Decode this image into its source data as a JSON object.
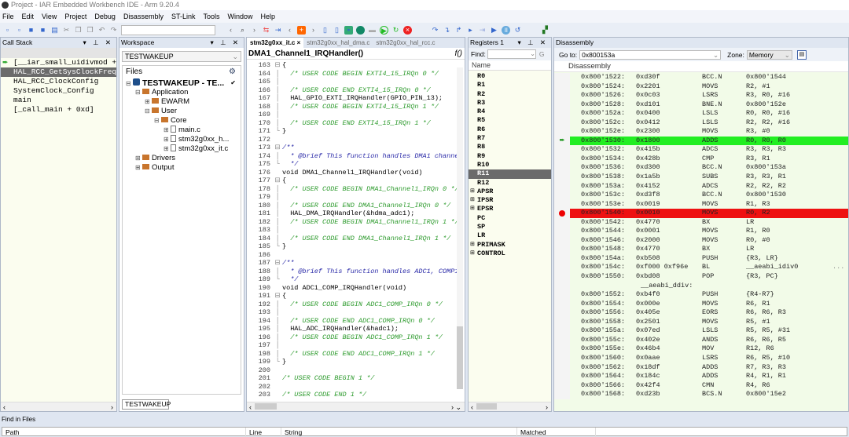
{
  "window": {
    "title": "Project - IAR Embedded Workbench IDE - Arm 9.20.4"
  },
  "menu": [
    "File",
    "Edit",
    "View",
    "Project",
    "Debug",
    "Disassembly",
    "ST-Link",
    "Tools",
    "Window",
    "Help"
  ],
  "call_stack": {
    "title": "Call Stack",
    "items": [
      "[__iar_small_uidivmod +",
      "HAL_RCC_GetSysClockFreq",
      "HAL_RCC_ClockConfig",
      "SystemClock_Config",
      "main",
      "[_call_main + 0xd]"
    ],
    "selected": 1,
    "current": 0
  },
  "workspace": {
    "title": "Workspace",
    "config": "TESTWAKEUP",
    "files_header": "Files",
    "bottom_tab": "TESTWAKEUP",
    "tree": [
      {
        "label": "TESTWAKEUP - TE...",
        "depth": 0,
        "kind": "project"
      },
      {
        "label": "Application",
        "depth": 1,
        "kind": "folder"
      },
      {
        "label": "EWARM",
        "depth": 2,
        "kind": "folder"
      },
      {
        "label": "User",
        "depth": 2,
        "kind": "folder"
      },
      {
        "label": "Core",
        "depth": 3,
        "kind": "folder"
      },
      {
        "label": "main.c",
        "depth": 4,
        "kind": "file"
      },
      {
        "label": "stm32g0xx_h...",
        "depth": 4,
        "kind": "file"
      },
      {
        "label": "stm32g0xx_it.c",
        "depth": 4,
        "kind": "file"
      },
      {
        "label": "Drivers",
        "depth": 1,
        "kind": "folder"
      },
      {
        "label": "Output",
        "depth": 1,
        "kind": "folder"
      }
    ]
  },
  "editor": {
    "tabs": [
      "stm32g0xx_it.c",
      "stm32g0xx_hal_dma.c",
      "stm32g0xx_hal_rcc.c"
    ],
    "active_tab": 0,
    "function": "DMA1_Channel1_IRQHandler()",
    "lines": [
      {
        "n": "163",
        "f": "⊟",
        "t": "{",
        "c": ""
      },
      {
        "n": "164",
        "f": "│",
        "t": "  /* USER CODE BEGIN EXTI4_15_IRQn 0 */",
        "c": "c-com"
      },
      {
        "n": "165",
        "f": "│",
        "t": "",
        "c": ""
      },
      {
        "n": "166",
        "f": "│",
        "t": "  /* USER CODE END EXTI4_15_IRQn 0 */",
        "c": "c-com"
      },
      {
        "n": "167",
        "f": "│",
        "t": "  HAL_GPIO_EXTI_IRQHandler(GPIO_PIN_13);",
        "c": ""
      },
      {
        "n": "168",
        "f": "│",
        "t": "  /* USER CODE BEGIN EXTI4_15_IRQn 1 */",
        "c": "c-com"
      },
      {
        "n": "169",
        "f": "│",
        "t": "",
        "c": ""
      },
      {
        "n": "170",
        "f": "│",
        "t": "  /* USER CODE END EXTI4_15_IRQn 1 */",
        "c": "c-com"
      },
      {
        "n": "171",
        "f": "└",
        "t": "}",
        "c": ""
      },
      {
        "n": "172",
        "f": "",
        "t": "",
        "c": ""
      },
      {
        "n": "173",
        "f": "⊟",
        "t": "/**",
        "c": "c-doc"
      },
      {
        "n": "174",
        "f": "│",
        "t": "  * @brief This function handles DMA1 channe",
        "c": "c-doc"
      },
      {
        "n": "175",
        "f": "└",
        "t": "  */",
        "c": "c-doc"
      },
      {
        "n": "176",
        "f": "",
        "t": "void DMA1_Channel1_IRQHandler(void)",
        "c": ""
      },
      {
        "n": "177",
        "f": "⊟",
        "t": "{",
        "c": ""
      },
      {
        "n": "178",
        "f": "│",
        "t": "  /* USER CODE BEGIN DMA1_Channel1_IRQn 0 */",
        "c": "c-com"
      },
      {
        "n": "179",
        "f": "│",
        "t": "",
        "c": ""
      },
      {
        "n": "180",
        "f": "│",
        "t": "  /* USER CODE END DMA1_Channel1_IRQn 0 */",
        "c": "c-com"
      },
      {
        "n": "181",
        "f": "│",
        "t": "  HAL_DMA_IRQHandler(&hdma_adc1);",
        "c": ""
      },
      {
        "n": "182",
        "f": "│",
        "t": "  /* USER CODE BEGIN DMA1_Channel1_IRQn 1 */",
        "c": "c-com"
      },
      {
        "n": "183",
        "f": "│",
        "t": "",
        "c": ""
      },
      {
        "n": "184",
        "f": "│",
        "t": "  /* USER CODE END DMA1_Channel1_IRQn 1 */",
        "c": "c-com"
      },
      {
        "n": "185",
        "f": "└",
        "t": "}",
        "c": ""
      },
      {
        "n": "186",
        "f": "",
        "t": "",
        "c": ""
      },
      {
        "n": "187",
        "f": "⊟",
        "t": "/**",
        "c": "c-doc"
      },
      {
        "n": "188",
        "f": "│",
        "t": "  * @brief This function handles ADC1, COMP1",
        "c": "c-doc"
      },
      {
        "n": "189",
        "f": "└",
        "t": "  */",
        "c": "c-doc"
      },
      {
        "n": "190",
        "f": "",
        "t": "void ADC1_COMP_IRQHandler(void)",
        "c": ""
      },
      {
        "n": "191",
        "f": "⊟",
        "t": "{",
        "c": ""
      },
      {
        "n": "192",
        "f": "│",
        "t": "  /* USER CODE BEGIN ADC1_COMP_IRQn 0 */",
        "c": "c-com"
      },
      {
        "n": "193",
        "f": "│",
        "t": "",
        "c": ""
      },
      {
        "n": "194",
        "f": "│",
        "t": "  /* USER CODE END ADC1_COMP_IRQn 0 */",
        "c": "c-com"
      },
      {
        "n": "195",
        "f": "│",
        "t": "  HAL_ADC_IRQHandler(&hadc1);",
        "c": ""
      },
      {
        "n": "196",
        "f": "│",
        "t": "  /* USER CODE BEGIN ADC1_COMP_IRQn 1 */",
        "c": "c-com"
      },
      {
        "n": "197",
        "f": "│",
        "t": "",
        "c": ""
      },
      {
        "n": "198",
        "f": "│",
        "t": "  /* USER CODE END ADC1_COMP_IRQn 1 */",
        "c": "c-com"
      },
      {
        "n": "199",
        "f": "└",
        "t": "}",
        "c": ""
      },
      {
        "n": "200",
        "f": "",
        "t": "",
        "c": ""
      },
      {
        "n": "201",
        "f": "",
        "t": "/* USER CODE BEGIN 1 */",
        "c": "c-com"
      },
      {
        "n": "202",
        "f": "",
        "t": "",
        "c": ""
      },
      {
        "n": "203",
        "f": "",
        "t": "/* USER CODE END 1 */",
        "c": "c-com"
      }
    ]
  },
  "registers": {
    "title": "Registers 1",
    "find_label": "Find:",
    "find_value": "",
    "col_header": "Name",
    "items": [
      {
        "name": "R0"
      },
      {
        "name": "R1"
      },
      {
        "name": "R2"
      },
      {
        "name": "R3"
      },
      {
        "name": "R4"
      },
      {
        "name": "R5"
      },
      {
        "name": "R6"
      },
      {
        "name": "R7"
      },
      {
        "name": "R8"
      },
      {
        "name": "R9"
      },
      {
        "name": "R10"
      },
      {
        "name": "R11",
        "selected": true
      },
      {
        "name": "R12"
      },
      {
        "name": "APSR",
        "expand": true
      },
      {
        "name": "IPSR",
        "expand": true
      },
      {
        "name": "EPSR",
        "expand": true
      },
      {
        "name": "PC"
      },
      {
        "name": "SP"
      },
      {
        "name": "LR"
      },
      {
        "name": "PRIMASK",
        "expand": true
      },
      {
        "name": "CONTROL",
        "expand": true
      }
    ]
  },
  "disassembly": {
    "title": "Disassembly",
    "goto_label": "Go to:",
    "goto_value": "0x800153a",
    "zone_label": "Zone:",
    "zone_value": "Memory",
    "col_header": "Disassembly",
    "rows": [
      {
        "a": "0x800'1522:",
        "h": "0xd30f",
        "m": "BCC.N",
        "o": "0x800'1544"
      },
      {
        "a": "0x800'1524:",
        "h": "0x2201",
        "m": "MOVS",
        "o": "R2, #1"
      },
      {
        "a": "0x800'1526:",
        "h": "0x0c03",
        "m": "LSRS",
        "o": "R3, R0, #16"
      },
      {
        "a": "0x800'1528:",
        "h": "0xd101",
        "m": "BNE.N",
        "o": "0x800'152e"
      },
      {
        "a": "0x800'152a:",
        "h": "0x0400",
        "m": "LSLS",
        "o": "R0, R0, #16"
      },
      {
        "a": "0x800'152c:",
        "h": "0x0412",
        "m": "LSLS",
        "o": "R2, R2, #16"
      },
      {
        "a": "0x800'152e:",
        "h": "0x2300",
        "m": "MOVS",
        "o": "R3, #0"
      },
      {
        "a": "0x800'1530:",
        "h": "0x1800",
        "m": "ADDS",
        "o": "R0, R0, R0",
        "state": "current"
      },
      {
        "a": "0x800'1532:",
        "h": "0x415b",
        "m": "ADCS",
        "o": "R3, R3, R3"
      },
      {
        "a": "0x800'1534:",
        "h": "0x428b",
        "m": "CMP",
        "o": "R3, R1"
      },
      {
        "a": "0x800'1536:",
        "h": "0xd300",
        "m": "BCC.N",
        "o": "0x800'153a"
      },
      {
        "a": "0x800'1538:",
        "h": "0x1a5b",
        "m": "SUBS",
        "o": "R3, R3, R1"
      },
      {
        "a": "0x800'153a:",
        "h": "0x4152",
        "m": "ADCS",
        "o": "R2, R2, R2"
      },
      {
        "a": "0x800'153c:",
        "h": "0xd3f8",
        "m": "BCC.N",
        "o": "0x800'1530"
      },
      {
        "a": "0x800'153e:",
        "h": "0x0019",
        "m": "MOVS",
        "o": "R1, R3"
      },
      {
        "a": "0x800'1540:",
        "h": "0x0010",
        "m": "MOVS",
        "o": "R0, R2",
        "state": "breakpoint"
      },
      {
        "a": "0x800'1542:",
        "h": "0x4770",
        "m": "BX",
        "o": "LR"
      },
      {
        "a": "0x800'1544:",
        "h": "0x0001",
        "m": "MOVS",
        "o": "R1, R0"
      },
      {
        "a": "0x800'1546:",
        "h": "0x2000",
        "m": "MOVS",
        "o": "R0, #0"
      },
      {
        "a": "0x800'1548:",
        "h": "0x4770",
        "m": "BX",
        "o": "LR"
      },
      {
        "a": "0x800'154a:",
        "h": "0xb508",
        "m": "PUSH",
        "o": "{R3, LR}"
      },
      {
        "a": "0x800'154c:",
        "h": "0xf000 0xf96e",
        "m": "BL",
        "o": "__aeabi_idiv0",
        "x": "..."
      },
      {
        "a": "0x800'1550:",
        "h": "0xbd08",
        "m": "POP",
        "o": "{R3, PC}"
      },
      {
        "label": "__aeabi_ddiv:"
      },
      {
        "a": "0x800'1552:",
        "h": "0xb4f0",
        "m": "PUSH",
        "o": "{R4-R7}"
      },
      {
        "a": "0x800'1554:",
        "h": "0x000e",
        "m": "MOVS",
        "o": "R6, R1"
      },
      {
        "a": "0x800'1556:",
        "h": "0x405e",
        "m": "EORS",
        "o": "R6, R6, R3"
      },
      {
        "a": "0x800'1558:",
        "h": "0x2501",
        "m": "MOVS",
        "o": "R5, #1"
      },
      {
        "a": "0x800'155a:",
        "h": "0x07ed",
        "m": "LSLS",
        "o": "R5, R5, #31"
      },
      {
        "a": "0x800'155c:",
        "h": "0x402e",
        "m": "ANDS",
        "o": "R6, R6, R5"
      },
      {
        "a": "0x800'155e:",
        "h": "0x46b4",
        "m": "MOV",
        "o": "R12, R6"
      },
      {
        "a": "0x800'1560:",
        "h": "0x0aae",
        "m": "LSRS",
        "o": "R6, R5, #10"
      },
      {
        "a": "0x800'1562:",
        "h": "0x18df",
        "m": "ADDS",
        "o": "R7, R3, R3"
      },
      {
        "a": "0x800'1564:",
        "h": "0x184c",
        "m": "ADDS",
        "o": "R4, R1, R1"
      },
      {
        "a": "0x800'1566:",
        "h": "0x42f4",
        "m": "CMN",
        "o": "R4, R6"
      },
      {
        "a": "0x800'1568:",
        "h": "0xd23b",
        "m": "BCS.N",
        "o": "0x800'15e2"
      }
    ]
  },
  "find_in_files": {
    "title": "Find in Files",
    "columns": [
      "Path",
      "Line",
      "String",
      "Matched"
    ]
  },
  "colors": {
    "current_line": "#22ee22",
    "breakpoint": "#ee1111",
    "disasm_bg": "#f2fbe8",
    "panel_bg": "#fbfdef"
  }
}
